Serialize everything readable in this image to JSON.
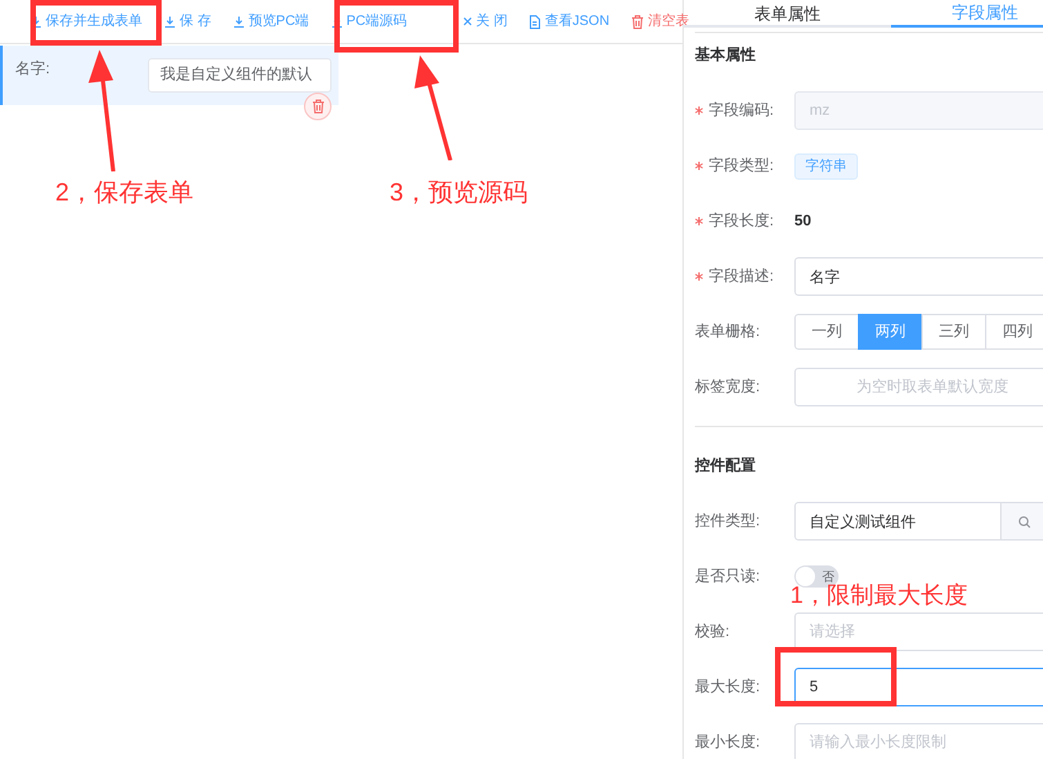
{
  "toolbar": [
    {
      "label": "保存并生成表单",
      "kind": "download",
      "danger": false
    },
    {
      "label": "保 存",
      "kind": "download",
      "danger": false
    },
    {
      "label": "预览PC端",
      "kind": "download",
      "danger": false
    },
    {
      "label": "PC端源码",
      "kind": "download",
      "danger": false
    },
    {
      "label": "关 闭",
      "kind": "close",
      "danger": false
    },
    {
      "label": "查看JSON",
      "kind": "doc",
      "danger": false
    },
    {
      "label": "清空表",
      "kind": "delete",
      "danger": true
    }
  ],
  "canvas": {
    "items": [
      {
        "label": "名字:",
        "value": "我是自定义组件的默认",
        "selected": true
      }
    ]
  },
  "panel": {
    "tabs": [
      {
        "label": "表单属性",
        "selected": false
      },
      {
        "label": "字段属性",
        "selected": true
      }
    ],
    "rows": [
      {
        "kind": "section",
        "label": "基本属性"
      },
      {
        "kind": "input",
        "label": "字段编码:",
        "required": true,
        "disabled": true,
        "value": "mz"
      },
      {
        "kind": "tag",
        "label": "字段类型:",
        "required": true,
        "value": "字符串"
      },
      {
        "kind": "text",
        "label": "字段长度:",
        "required": true,
        "value": "50"
      },
      {
        "kind": "input",
        "label": "字段描述:",
        "required": true,
        "value": "名字"
      },
      {
        "kind": "segmented",
        "label": "表单栅格:",
        "options": [
          {
            "label": "一列",
            "selected": false
          },
          {
            "label": "两列",
            "selected": true
          },
          {
            "label": "三列",
            "selected": false
          },
          {
            "label": "四列",
            "selected": false
          }
        ]
      },
      {
        "kind": "input",
        "label": "标签宽度:",
        "placeholder": "为空时取表单默认宽度",
        "centered": true
      },
      {
        "kind": "divider"
      },
      {
        "kind": "section",
        "label": "控件配置"
      },
      {
        "kind": "picker",
        "label": "控件类型:",
        "value": "自定义测试组件"
      },
      {
        "kind": "switch",
        "label": "是否只读:",
        "on": false,
        "text": "否"
      },
      {
        "kind": "input",
        "label": "校验:",
        "placeholder": "请选择"
      },
      {
        "kind": "input",
        "label": "最大长度:",
        "value": "5",
        "focused": true
      },
      {
        "kind": "input",
        "label": "最小长度:",
        "placeholder": "请输入最小长度限制"
      }
    ]
  },
  "annotations": [
    {
      "text": "2，保存表单"
    },
    {
      "text": "3，预览源码"
    },
    {
      "text": "1，限制最大长度"
    }
  ]
}
